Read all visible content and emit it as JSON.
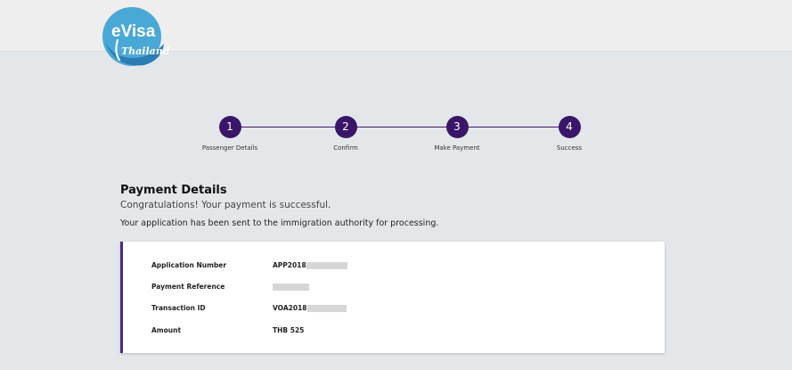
{
  "header": {
    "logo": {
      "icon": "evisa-thailand-logo",
      "text_main": "eVisa",
      "text_script": "Thailand",
      "colors": {
        "primary": "#4aa8d6",
        "dark": "#2b7db4",
        "script": "#ffffff"
      }
    }
  },
  "stepper": {
    "active_color": "#3a1668",
    "steps": [
      {
        "number": "1",
        "label": "Passenger Details"
      },
      {
        "number": "2",
        "label": "Confirm"
      },
      {
        "number": "3",
        "label": "Make Payment"
      },
      {
        "number": "4",
        "label": "Success"
      }
    ]
  },
  "payment": {
    "title": "Payment Details",
    "congrats": "Congratulations! Your payment is successful.",
    "message": "Your application has been sent to the immigration authority for processing.",
    "rows": [
      {
        "label": "Application Number",
        "value": "APP2018",
        "redacted": true
      },
      {
        "label": "Payment Reference",
        "value": "",
        "redacted": true
      },
      {
        "label": "Transaction ID",
        "value": "VOA2018",
        "redacted": true
      },
      {
        "label": "Amount",
        "value": "THB 525",
        "redacted": false
      }
    ],
    "accent_color": "#4a2a82"
  }
}
